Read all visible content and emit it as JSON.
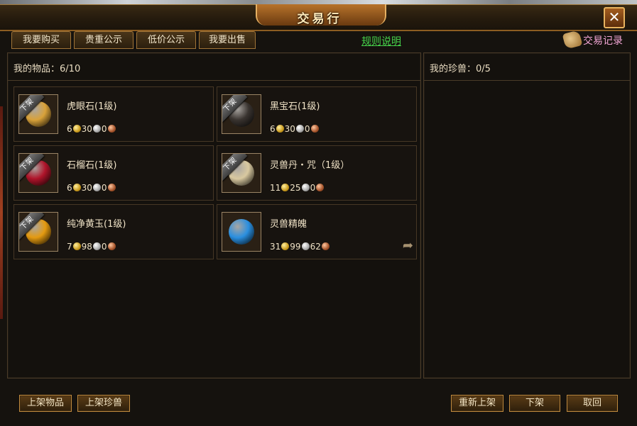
{
  "window": {
    "title": "交易行",
    "close_symbol": "✕"
  },
  "tabs": [
    {
      "label": "我要购买"
    },
    {
      "label": "贵重公示"
    },
    {
      "label": "低价公示"
    },
    {
      "label": "我要出售"
    }
  ],
  "rules_link": "规则说明",
  "trade_log": {
    "label": "交易记录",
    "icon": "scroll-icon"
  },
  "items_panel": {
    "label": "我的物品：",
    "count": "6/10",
    "items": [
      {
        "name": "虎眼石(1级)",
        "tag": "下架",
        "icon": "tiger-eye-stone-icon",
        "color": "#d9a23a",
        "gold": "6",
        "silver": "30",
        "copper": "0"
      },
      {
        "name": "黑宝石(1级)",
        "tag": "下架",
        "icon": "black-gem-icon",
        "color": "#3a3430",
        "gold": "6",
        "silver": "30",
        "copper": "0"
      },
      {
        "name": "石榴石(1级)",
        "tag": "下架",
        "icon": "garnet-icon",
        "color": "#b0142a",
        "gold": "6",
        "silver": "30",
        "copper": "0"
      },
      {
        "name": "灵兽丹・咒（1级）",
        "tag": "下架",
        "icon": "crystal-ball-icon",
        "color": "#d9c9a0",
        "gold": "11",
        "silver": "25",
        "copper": "0"
      },
      {
        "name": "纯净黄玉(1级)",
        "tag": "下架",
        "icon": "topaz-icon",
        "color": "#e49a10",
        "gold": "7",
        "silver": "98",
        "copper": "0"
      },
      {
        "name": "灵兽精魄",
        "tag": "",
        "icon": "spirit-essence-icon",
        "color": "#2a8fe0",
        "gold": "31",
        "silver": "99",
        "copper": "62"
      }
    ]
  },
  "pets_panel": {
    "label": "我的珍兽：",
    "count": "0/5"
  },
  "bottom_buttons": {
    "list_item": "上架物品",
    "list_pet": "上架珍兽",
    "relist": "重新上架",
    "delist": "下架",
    "cancel": "取回"
  },
  "colors": {
    "accent": "#c08a3e",
    "link": "#46d24a",
    "trade_log": "#f3a6d5"
  }
}
